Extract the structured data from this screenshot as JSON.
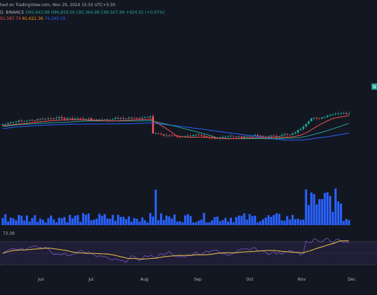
{
  "header": {
    "published_text": "hed on TradingView.com, Nov 29, 2024 15:55 UTC+5:30",
    "symbol_text": "D, BINANCE",
    "ohlc": {
      "open": "O95,643.98",
      "high": "H96,859.00",
      "low": "L95,364.99",
      "close": "C96,567.99",
      "change": "+924.01 (+0.97%)"
    },
    "ma_values": [
      "91,587.74",
      "81,621.36",
      "74,240.19"
    ]
  },
  "rsi": {
    "value": "73.39"
  },
  "price_marker": {
    "text": "N"
  },
  "x_axis": {
    "labels": [
      "Jun",
      "Jul",
      "Aug",
      "Sep",
      "Oct",
      "Nov",
      "Dec"
    ]
  },
  "colors": {
    "background": "#131722",
    "up": "#26a69a",
    "down": "#ef5350",
    "volume": "#2962ff",
    "ma_fast": "#ef5350",
    "ma_mid": "#ff9800",
    "ma_slow": "#2962ff",
    "rsi_line": "#7e57c2",
    "rsi_ma": "#f7c948",
    "rsi_band": "#2a2547"
  }
}
